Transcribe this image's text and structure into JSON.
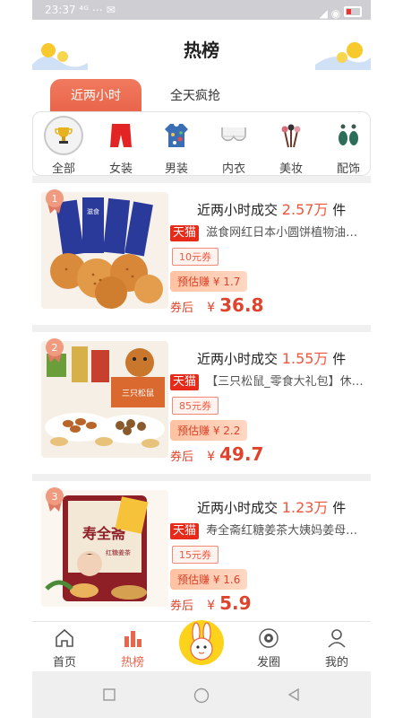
{
  "status_bar": {
    "time": "23:37 ⁴ᴳ ⋯ ✉",
    "signal": "◢ ◉"
  },
  "header": {
    "title": "热榜"
  },
  "tabs": [
    {
      "label": "近两小时",
      "active": true
    },
    {
      "label": "全天疯抢",
      "active": false
    }
  ],
  "categories": [
    {
      "label": "全部",
      "icon": "trophy-icon"
    },
    {
      "label": "女装",
      "icon": "red-shorts-icon"
    },
    {
      "label": "男装",
      "icon": "patterned-shirt-icon"
    },
    {
      "label": "内衣",
      "icon": "bra-icon"
    },
    {
      "label": "美妆",
      "icon": "makeup-brushes-icon"
    },
    {
      "label": "配饰",
      "icon": "earrings-icon"
    }
  ],
  "products": [
    {
      "rank": "1",
      "sold_prefix": "近两小时成交",
      "sold_num": "2.57万",
      "sold_suffix": "件",
      "platform": "天猫",
      "title": "滋食网红日本小圆饼植物油饼...",
      "coupon": "10元券",
      "earn": "预估赚 ¥ 1.7",
      "price_label": "券后",
      "currency": "¥",
      "price": "36.8"
    },
    {
      "rank": "2",
      "sold_prefix": "近两小时成交",
      "sold_num": "1.55万",
      "sold_suffix": "件",
      "platform": "天猫",
      "title": "【三只松鼠_零食大礼包】休闲...",
      "coupon": "85元券",
      "earn": "预估赚 ¥ 2.2",
      "price_label": "券后",
      "currency": "¥",
      "price": "49.7"
    },
    {
      "rank": "3",
      "sold_prefix": "近两小时成交",
      "sold_num": "1.23万",
      "sold_suffix": "件",
      "platform": "天猫",
      "title": "寿全斋红糖姜茶大姨妈姜母茶...",
      "coupon": "15元券",
      "earn": "预估赚 ¥ 1.6",
      "price_label": "券后",
      "currency": "¥",
      "price": "5.9"
    }
  ],
  "bottom_nav": [
    {
      "label": "首页",
      "icon": "home-icon",
      "active": false
    },
    {
      "label": "热榜",
      "icon": "bar-chart-icon",
      "active": true
    },
    {
      "label": "",
      "icon": "bunny-center-icon",
      "active": false
    },
    {
      "label": "发圈",
      "icon": "camera-icon",
      "active": false
    },
    {
      "label": "我的",
      "icon": "user-icon",
      "active": false
    }
  ],
  "product_image_text": {
    "p1_pack": "滋食",
    "p2_box": "三只松鼠",
    "p3_brand": "寿全斋",
    "p3_name": "红糖姜茶"
  },
  "colors": {
    "accent": "#e9644a",
    "price": "#e0432b",
    "tmall": "#e62b1a",
    "center_btn": "#fcd21a"
  }
}
